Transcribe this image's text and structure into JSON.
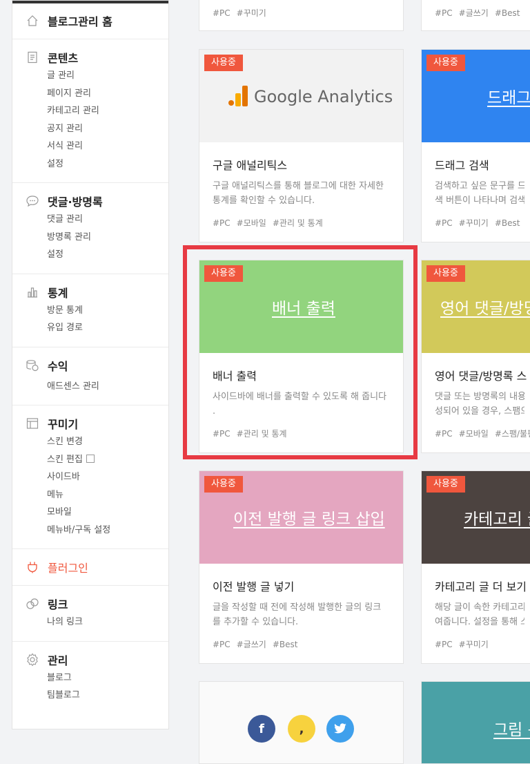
{
  "sidebar": {
    "home": "블로그관리 홈",
    "sections": [
      {
        "title": "콘텐츠",
        "items": [
          "글 관리",
          "페이지 관리",
          "카테고리 관리",
          "공지 관리",
          "서식 관리",
          "설정"
        ]
      },
      {
        "title": "댓글·방명록",
        "items": [
          "댓글 관리",
          "방명록 관리",
          "설정"
        ]
      },
      {
        "title": "통계",
        "items": [
          "방문 통계",
          "유입 경로"
        ]
      },
      {
        "title": "수익",
        "items": [
          "애드센스 관리"
        ]
      },
      {
        "title": "꾸미기",
        "items": [
          "스킨 변경",
          "스킨 편집",
          "사이드바",
          "메뉴",
          "모바일",
          "메뉴바/구독 설정"
        ]
      },
      {
        "title": "플러그인",
        "items": []
      },
      {
        "title": "링크",
        "items": [
          "나의 링크"
        ]
      },
      {
        "title": "관리",
        "items": [
          "블로그",
          "팀블로그"
        ]
      }
    ]
  },
  "top_tags": {
    "left": [
      "#PC",
      "#꾸미기"
    ],
    "right": [
      "#PC",
      "#글쓰기",
      "#Best"
    ]
  },
  "cards": [
    {
      "badge": "사용중",
      "thumb_text": "Google Analytics",
      "title": "구글 애널리틱스",
      "desc1": "구글 애널리틱스를 통해 블로그에 대한 자세한",
      "desc2": "통계를 확인할 수 있습니다.",
      "tags": [
        "#PC",
        "#모바일",
        "#관리 및 통계"
      ]
    },
    {
      "badge": "사용중",
      "thumb_text": "드래그",
      "title": "드래그 검색",
      "desc1": "검색하고 싶은 문구를 드",
      "desc2": "색 버튼이 나타나며 검색",
      "tags": [
        "#PC",
        "#꾸미기",
        "#Best"
      ]
    },
    {
      "badge": "사용중",
      "thumb_text": "배너 출력",
      "title": "배너 출력",
      "desc1": "사이드바에 배너를 출력할 수 있도록 해 줍니다",
      "desc2": ".",
      "tags": [
        "#PC",
        "#관리 및 통계"
      ]
    },
    {
      "badge": "사용중",
      "thumb_text": "영어 댓글/방명",
      "title": "영어 댓글/방명록 스",
      "desc1": "댓글 또는 방명록의 내용이",
      "desc2": "성되어 있을 경우, 스팸으",
      "tags": [
        "#PC",
        "#모바일",
        "#스팸/불편"
      ]
    },
    {
      "badge": "사용중",
      "thumb_text": "이전 발행 글 링크 삽입",
      "title": "이전 발행 글 넣기",
      "desc1": "글을 작성할 때 전에 작성해 발행한 글의 링크",
      "desc2": "를 추가할 수 있습니다.",
      "tags": [
        "#PC",
        "#글쓰기",
        "#Best"
      ]
    },
    {
      "badge": "사용중",
      "thumb_text": "카테고리 글",
      "title": "카테고리 글 더 보기",
      "desc1": "해당 글이 속한 카테고리의",
      "desc2": "여줍니다. 설정을 통해 스",
      "tags": [
        "#PC",
        "#꾸미기"
      ]
    },
    {
      "thumb_text": "그림 문"
    }
  ],
  "social": [
    "f",
    ",",
    "t"
  ]
}
